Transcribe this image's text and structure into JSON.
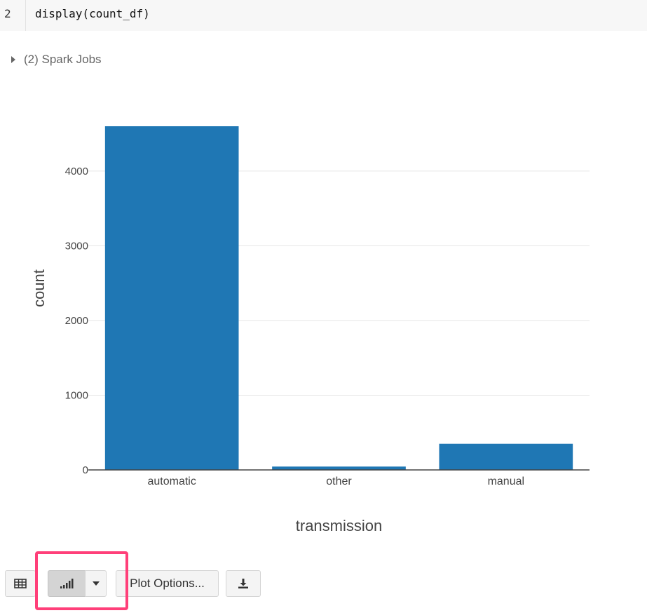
{
  "code": {
    "line_number": "2",
    "text": "display(count_df)"
  },
  "jobs": {
    "label": "(2) Spark Jobs"
  },
  "toolbar": {
    "plot_options_label": "Plot Options..."
  },
  "icons": {
    "table": "table-icon",
    "bar_chart": "bar-chart-icon",
    "dropdown": "chevron-down-icon",
    "download": "download-icon",
    "expand": "caret-right-icon"
  },
  "colors": {
    "bar": "#1f77b4",
    "highlight": "#ff3f79"
  },
  "chart_data": {
    "type": "bar",
    "categories": [
      "automatic",
      "other",
      "manual"
    ],
    "values": [
      4600,
      45,
      350
    ],
    "xlabel": "transmission",
    "ylabel": "count",
    "ylim": [
      0,
      4600
    ],
    "yticks": [
      0,
      1000,
      2000,
      3000,
      4000
    ],
    "grid": true
  }
}
